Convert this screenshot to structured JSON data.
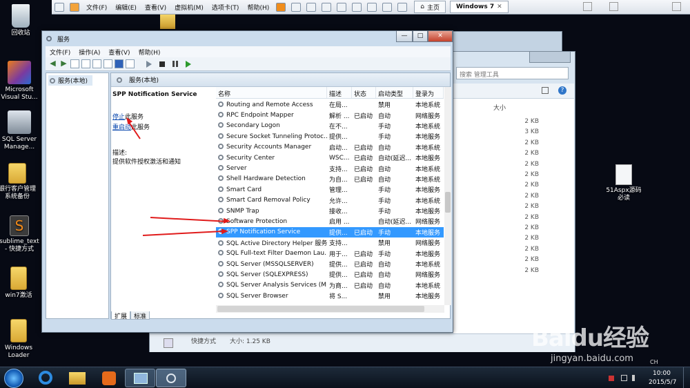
{
  "vmware": {
    "menus": [
      "文件(F)",
      "编辑(E)",
      "查看(V)",
      "虚拟机(M)",
      "选项卡(T)",
      "帮助(H)"
    ],
    "home_tab": "主页",
    "vm_tab": "Windows 7",
    "vm_tab_close": "✕"
  },
  "desktop": {
    "icons": [
      {
        "label": "回收站"
      },
      {
        "label": "Microsoft Visual Stu..."
      },
      {
        "label": "SQL Server Manage..."
      },
      {
        "label": "银行客户管理系统备份"
      },
      {
        "label": "sublime_text - 快捷方式"
      },
      {
        "label": "win7激活"
      },
      {
        "label": "Windows Loader"
      }
    ],
    "file_icon": {
      "label": "51Aspx源码必读"
    }
  },
  "explorer": {
    "search_placeholder": "搜索 管理工具",
    "column_size": "大小",
    "sizes": [
      "2 KB",
      "3 KB",
      "2 KB",
      "2 KB",
      "2 KB",
      "2 KB",
      "2 KB",
      "2 KB",
      "2 KB",
      "2 KB",
      "2 KB",
      "2 KB",
      "2 KB",
      "2 KB",
      "2 KB"
    ],
    "footer_type": "快捷方式",
    "footer_size": "大小: 1.25 KB"
  },
  "services_window": {
    "title": "服务",
    "caption_min": "—",
    "caption_max": "□",
    "caption_close": "✕",
    "menus": [
      "文件(F)",
      "操作(A)",
      "查看(V)",
      "帮助(H)"
    ],
    "tree_item": "服务(本地)",
    "header": "服务(本地)",
    "selected_service": "SPP Notification Service",
    "stop_link": "停止",
    "stop_suffix": "此服务",
    "restart_link": "重启动",
    "restart_suffix": "此服务",
    "desc_label": "描述:",
    "desc_text": "提供软件授权激活和通知",
    "columns": [
      "名称",
      "描述",
      "状态",
      "启动类型",
      "登录为"
    ],
    "rows": [
      [
        "Routing and Remote Access",
        "在局...",
        "",
        "禁用",
        "本地系统"
      ],
      [
        "RPC Endpoint Mapper",
        "解析 ...",
        "已启动",
        "自动",
        "网络服务"
      ],
      [
        "Secondary Logon",
        "在不...",
        "",
        "手动",
        "本地系统"
      ],
      [
        "Secure Socket Tunneling Protoc...",
        "提供...",
        "",
        "手动",
        "本地服务"
      ],
      [
        "Security Accounts Manager",
        "启动...",
        "已启动",
        "自动",
        "本地系统"
      ],
      [
        "Security Center",
        "WSC...",
        "已启动",
        "自动(延迟...",
        "本地服务"
      ],
      [
        "Server",
        "支持...",
        "已启动",
        "自动",
        "本地系统"
      ],
      [
        "Shell Hardware Detection",
        "为自...",
        "已启动",
        "自动",
        "本地系统"
      ],
      [
        "Smart Card",
        "管理...",
        "",
        "手动",
        "本地服务"
      ],
      [
        "Smart Card Removal Policy",
        "允许...",
        "",
        "手动",
        "本地系统"
      ],
      [
        "SNMP Trap",
        "接收...",
        "",
        "手动",
        "本地服务"
      ],
      [
        "Software Protection",
        "启用 ...",
        "",
        "自动(延迟...",
        "网络服务"
      ],
      [
        "SPP Notification Service",
        "提供...",
        "已启动",
        "手动",
        "本地服务"
      ],
      [
        "SQL Active Directory Helper 服务",
        "支持...",
        "",
        "禁用",
        "网络服务"
      ],
      [
        "SQL Full-text Filter Daemon Lau...",
        "用于...",
        "已启动",
        "手动",
        "本地服务"
      ],
      [
        "SQL Server (MSSQLSERVER)",
        "提供...",
        "已启动",
        "自动",
        "本地系统"
      ],
      [
        "SQL Server (SQLEXPRESS)",
        "提供...",
        "已启动",
        "自动",
        "网络服务"
      ],
      [
        "SQL Server Analysis Services (M...",
        "为商...",
        "已启动",
        "自动",
        "本地系统"
      ],
      [
        "SQL Server Browser",
        "将 S...",
        "",
        "禁用",
        "本地服务"
      ]
    ],
    "tabs": [
      "扩展",
      "标准"
    ]
  },
  "taskbar": {
    "time": "10:00",
    "date": "2015/5/7",
    "ch": "CH"
  },
  "watermark": {
    "brand": "Baidu经验",
    "url": "jingyan.baidu.com"
  },
  "colors": {
    "selection": "#3399ff",
    "annotation": "#e01b1b",
    "link": "#0645ad"
  }
}
